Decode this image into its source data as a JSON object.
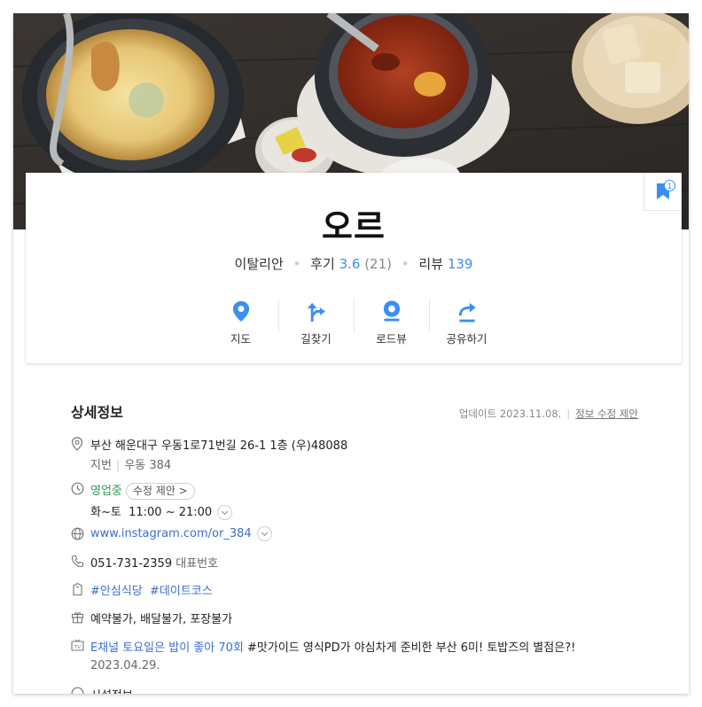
{
  "place": {
    "name": "오르",
    "category": "이탈리안",
    "review_label": "후기",
    "rating": "3.6",
    "rating_count": "(21)",
    "blog_review_label": "리뷰",
    "blog_review_count": "139",
    "bookmark_count": "1"
  },
  "actions": [
    {
      "label": "지도",
      "icon": "map-pin-icon"
    },
    {
      "label": "길찾기",
      "icon": "directions-icon"
    },
    {
      "label": "로드뷰",
      "icon": "roadview-icon"
    },
    {
      "label": "공유하기",
      "icon": "share-icon"
    }
  ],
  "details": {
    "title": "상세정보",
    "updated_label": "업데이트 2023.11.08.",
    "suggest_edit_link": "정보 수정 제안",
    "address": "부산 해운대구 우동1로71번길 26-1 1층 (우)48088",
    "lot_label": "지번",
    "lot_value": "우동 384",
    "status": "영업중",
    "edit_suggest_pill": "수정 제안 >",
    "hours_days": "화~토",
    "hours_time": "11:00 ~ 21:00",
    "website": "www.instagram.com/or_384",
    "phone": "051-731-2359",
    "phone_label": "대표번호",
    "tag1": "#안심식당",
    "tag2": "#데이트코스",
    "facilities": "예약불가, 배달불가, 포장불가",
    "tv_show_link": "E채널 토요일은 밥이 좋아 70회",
    "tv_show_desc": "#맛가이드 영식PD가 야심차게 준비한 부산 6미! 토밥즈의 별점은?!",
    "tv_date": "2023.04.29.",
    "next_section_cut": "시설정보"
  },
  "colors": {
    "accent": "#3a8ef6",
    "open": "#2f9a58",
    "link": "#3a6ed6"
  }
}
